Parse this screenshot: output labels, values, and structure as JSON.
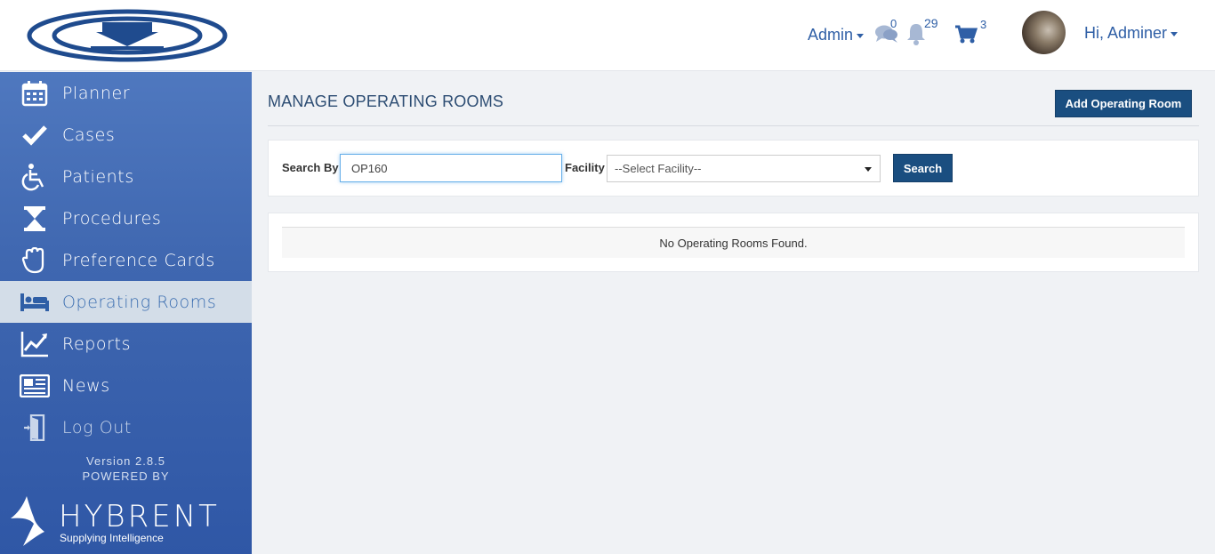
{
  "header": {
    "admin_menu_label": "Admin",
    "messages_count": "0",
    "notifications_count": "29",
    "cart_count": "3",
    "user_greeting": "Hi, Adminer"
  },
  "sidebar": {
    "items": [
      {
        "label": "Planner",
        "icon": "calendar-icon"
      },
      {
        "label": "Cases",
        "icon": "checkmark-icon"
      },
      {
        "label": "Patients",
        "icon": "wheelchair-icon"
      },
      {
        "label": "Procedures",
        "icon": "hourglass-icon"
      },
      {
        "label": "Preference Cards",
        "icon": "glove-icon"
      },
      {
        "label": "Operating Rooms",
        "icon": "bed-icon",
        "active": true
      },
      {
        "label": "Reports",
        "icon": "line-chart-icon"
      },
      {
        "label": "News",
        "icon": "newspaper-icon"
      },
      {
        "label": "Log Out",
        "icon": "door-exit-icon"
      }
    ],
    "version": "Version 2.8.5",
    "powered_by": "POWERED BY",
    "brand_name": "HYBRENT",
    "brand_tagline": "Supplying Intelligence"
  },
  "main": {
    "title": "MANAGE OPERATING ROOMS",
    "add_button": "Add Operating Room",
    "search": {
      "search_by_label": "Search By",
      "search_value": "OP160",
      "facility_label": "Facility",
      "facility_selected": "--Select Facility--",
      "search_button": "Search"
    },
    "empty_message": "No Operating Rooms Found."
  },
  "colors": {
    "sidebar": "#3f67b0",
    "active_item_bg": "#d3dde8",
    "primary_button": "#1a4e80",
    "header_link": "#2f5fa6"
  }
}
